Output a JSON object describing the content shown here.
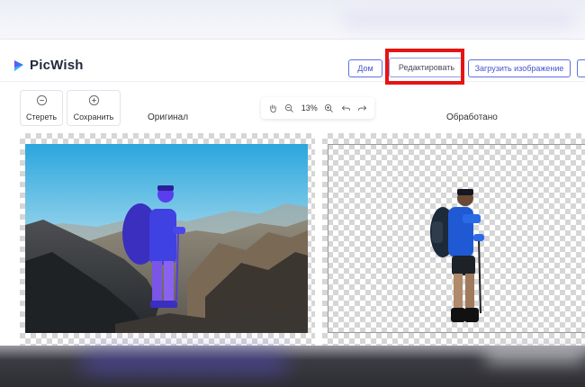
{
  "header": {
    "logo_text": "PicWish",
    "buttons": {
      "home": "Дом",
      "edit": "Редактировать",
      "upload": "Загрузить изображение"
    }
  },
  "toolbar": {
    "erase_label": "Стереть",
    "save_label": "Сохранить"
  },
  "zoom": {
    "value": "13%"
  },
  "panels": {
    "original_title": "Оригинал",
    "processed_title": "Обработано"
  },
  "colors": {
    "accent": "#5c6fe3",
    "highlight": "#e51515",
    "brand_blue": "#2f7cf6",
    "brand_purple": "#7a4df2"
  },
  "icons": [
    "hand-icon",
    "zoom-out-icon",
    "zoom-in-icon",
    "undo-icon",
    "redo-icon",
    "minus-circle-icon",
    "plus-circle-icon"
  ]
}
